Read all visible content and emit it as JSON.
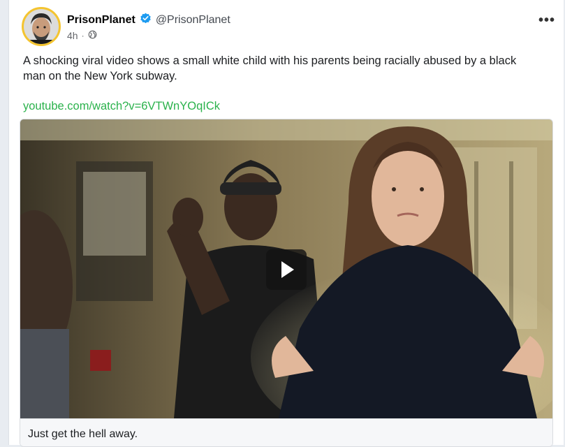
{
  "author": {
    "name": "PrisonPlanet",
    "handle": "@PrisonPlanet",
    "verified_icon": "verified-badge-icon",
    "verified_color": "#1d9bf0"
  },
  "meta": {
    "time": "4h",
    "separator": "·",
    "visibility_icon": "globe-icon"
  },
  "more_label": "•••",
  "post": {
    "text": "A shocking viral video shows a small white child with his parents being racially abused by a black man on the New York subway.",
    "link": "youtube.com/watch?v=6VTWnYOqICk",
    "link_color": "#2bb24c"
  },
  "card": {
    "play_icon": "play-icon",
    "caption": "Just get the hell away."
  }
}
